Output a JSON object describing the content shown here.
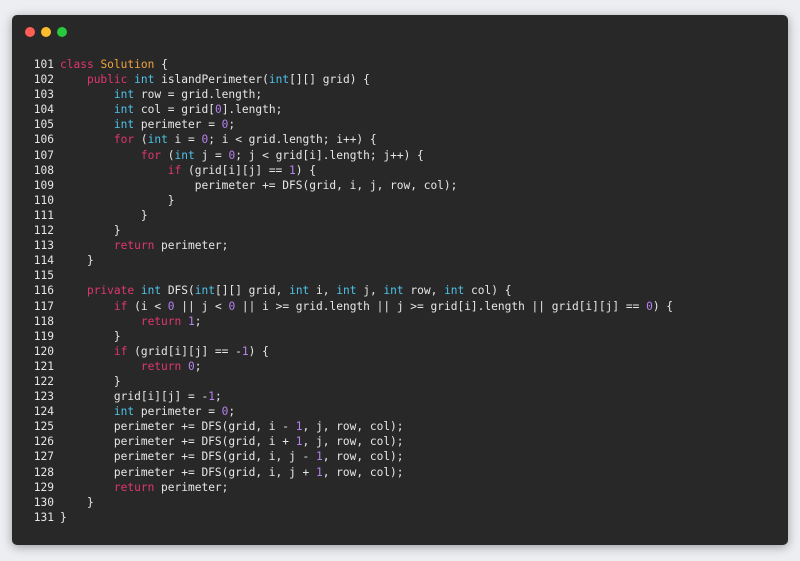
{
  "window": {
    "buttons": {
      "close": "close",
      "minimize": "minimize",
      "maximize": "maximize"
    }
  },
  "colors": {
    "keyword": "#e0366e",
    "type": "#4ec2e8",
    "class_name": "#f1a33b",
    "number": "#b682f0",
    "plain": "#e6e6e6",
    "background": "#282828"
  },
  "code": {
    "language": "java",
    "lines": [
      {
        "n": "101",
        "tokens": [
          [
            "kw",
            "class"
          ],
          [
            "pl",
            " "
          ],
          [
            "cn",
            "Solution"
          ],
          [
            "pl",
            " {"
          ]
        ]
      },
      {
        "n": "102",
        "tokens": [
          [
            "pl",
            "    "
          ],
          [
            "kw",
            "public"
          ],
          [
            "pl",
            " "
          ],
          [
            "ty",
            "int"
          ],
          [
            "pl",
            " islandPerimeter("
          ],
          [
            "ty",
            "int"
          ],
          [
            "pl",
            "[][] grid) {"
          ]
        ]
      },
      {
        "n": "103",
        "tokens": [
          [
            "pl",
            "        "
          ],
          [
            "ty",
            "int"
          ],
          [
            "pl",
            " row = grid.length;"
          ]
        ]
      },
      {
        "n": "104",
        "tokens": [
          [
            "pl",
            "        "
          ],
          [
            "ty",
            "int"
          ],
          [
            "pl",
            " col = grid["
          ],
          [
            "nu",
            "0"
          ],
          [
            "pl",
            "].length;"
          ]
        ]
      },
      {
        "n": "105",
        "tokens": [
          [
            "pl",
            "        "
          ],
          [
            "ty",
            "int"
          ],
          [
            "pl",
            " perimeter = "
          ],
          [
            "nu",
            "0"
          ],
          [
            "pl",
            ";"
          ]
        ]
      },
      {
        "n": "106",
        "tokens": [
          [
            "pl",
            "        "
          ],
          [
            "kw",
            "for"
          ],
          [
            "pl",
            " ("
          ],
          [
            "ty",
            "int"
          ],
          [
            "pl",
            " i = "
          ],
          [
            "nu",
            "0"
          ],
          [
            "pl",
            "; i < grid.length; i++) {"
          ]
        ]
      },
      {
        "n": "107",
        "tokens": [
          [
            "pl",
            "            "
          ],
          [
            "kw",
            "for"
          ],
          [
            "pl",
            " ("
          ],
          [
            "ty",
            "int"
          ],
          [
            "pl",
            " j = "
          ],
          [
            "nu",
            "0"
          ],
          [
            "pl",
            "; j < grid[i].length; j++) {"
          ]
        ]
      },
      {
        "n": "108",
        "tokens": [
          [
            "pl",
            "                "
          ],
          [
            "kw",
            "if"
          ],
          [
            "pl",
            " (grid[i][j] == "
          ],
          [
            "nu",
            "1"
          ],
          [
            "pl",
            ") {"
          ]
        ]
      },
      {
        "n": "109",
        "tokens": [
          [
            "pl",
            "                    perimeter += DFS(grid, i, j, row, col);"
          ]
        ]
      },
      {
        "n": "110",
        "tokens": [
          [
            "pl",
            "                }"
          ]
        ]
      },
      {
        "n": "111",
        "tokens": [
          [
            "pl",
            "            }"
          ]
        ]
      },
      {
        "n": "112",
        "tokens": [
          [
            "pl",
            "        }"
          ]
        ]
      },
      {
        "n": "113",
        "tokens": [
          [
            "pl",
            "        "
          ],
          [
            "kw",
            "return"
          ],
          [
            "pl",
            " perimeter;"
          ]
        ]
      },
      {
        "n": "114",
        "tokens": [
          [
            "pl",
            "    }"
          ]
        ]
      },
      {
        "n": "115",
        "tokens": [
          [
            "pl",
            ""
          ]
        ]
      },
      {
        "n": "116",
        "tokens": [
          [
            "pl",
            "    "
          ],
          [
            "kw",
            "private"
          ],
          [
            "pl",
            " "
          ],
          [
            "ty",
            "int"
          ],
          [
            "pl",
            " DFS("
          ],
          [
            "ty",
            "int"
          ],
          [
            "pl",
            "[][] grid, "
          ],
          [
            "ty",
            "int"
          ],
          [
            "pl",
            " i, "
          ],
          [
            "ty",
            "int"
          ],
          [
            "pl",
            " j, "
          ],
          [
            "ty",
            "int"
          ],
          [
            "pl",
            " row, "
          ],
          [
            "ty",
            "int"
          ],
          [
            "pl",
            " col) {"
          ]
        ]
      },
      {
        "n": "117",
        "tokens": [
          [
            "pl",
            "        "
          ],
          [
            "kw",
            "if"
          ],
          [
            "pl",
            " (i < "
          ],
          [
            "nu",
            "0"
          ],
          [
            "pl",
            " || j < "
          ],
          [
            "nu",
            "0"
          ],
          [
            "pl",
            " || i >= grid.length || j >= grid[i].length || grid[i][j] == "
          ],
          [
            "nu",
            "0"
          ],
          [
            "pl",
            ") {"
          ]
        ]
      },
      {
        "n": "118",
        "tokens": [
          [
            "pl",
            "            "
          ],
          [
            "kw",
            "return"
          ],
          [
            "pl",
            " "
          ],
          [
            "nu",
            "1"
          ],
          [
            "pl",
            ";"
          ]
        ]
      },
      {
        "n": "119",
        "tokens": [
          [
            "pl",
            "        }"
          ]
        ]
      },
      {
        "n": "120",
        "tokens": [
          [
            "pl",
            "        "
          ],
          [
            "kw",
            "if"
          ],
          [
            "pl",
            " (grid[i][j] == -"
          ],
          [
            "nu",
            "1"
          ],
          [
            "pl",
            ") {"
          ]
        ]
      },
      {
        "n": "121",
        "tokens": [
          [
            "pl",
            "            "
          ],
          [
            "kw",
            "return"
          ],
          [
            "pl",
            " "
          ],
          [
            "nu",
            "0"
          ],
          [
            "pl",
            ";"
          ]
        ]
      },
      {
        "n": "122",
        "tokens": [
          [
            "pl",
            "        }"
          ]
        ]
      },
      {
        "n": "123",
        "tokens": [
          [
            "pl",
            "        grid[i][j] = -"
          ],
          [
            "nu",
            "1"
          ],
          [
            "pl",
            ";"
          ]
        ]
      },
      {
        "n": "124",
        "tokens": [
          [
            "pl",
            "        "
          ],
          [
            "ty",
            "int"
          ],
          [
            "pl",
            " perimeter = "
          ],
          [
            "nu",
            "0"
          ],
          [
            "pl",
            ";"
          ]
        ]
      },
      {
        "n": "125",
        "tokens": [
          [
            "pl",
            "        perimeter += DFS(grid, i - "
          ],
          [
            "nu",
            "1"
          ],
          [
            "pl",
            ", j, row, col);"
          ]
        ]
      },
      {
        "n": "126",
        "tokens": [
          [
            "pl",
            "        perimeter += DFS(grid, i + "
          ],
          [
            "nu",
            "1"
          ],
          [
            "pl",
            ", j, row, col);"
          ]
        ]
      },
      {
        "n": "127",
        "tokens": [
          [
            "pl",
            "        perimeter += DFS(grid, i, j - "
          ],
          [
            "nu",
            "1"
          ],
          [
            "pl",
            ", row, col);"
          ]
        ]
      },
      {
        "n": "128",
        "tokens": [
          [
            "pl",
            "        perimeter += DFS(grid, i, j + "
          ],
          [
            "nu",
            "1"
          ],
          [
            "pl",
            ", row, col);"
          ]
        ]
      },
      {
        "n": "129",
        "tokens": [
          [
            "pl",
            "        "
          ],
          [
            "kw",
            "return"
          ],
          [
            "pl",
            " perimeter;"
          ]
        ]
      },
      {
        "n": "130",
        "tokens": [
          [
            "pl",
            "    }"
          ]
        ]
      },
      {
        "n": "131",
        "tokens": [
          [
            "pl",
            "}"
          ]
        ]
      }
    ]
  }
}
